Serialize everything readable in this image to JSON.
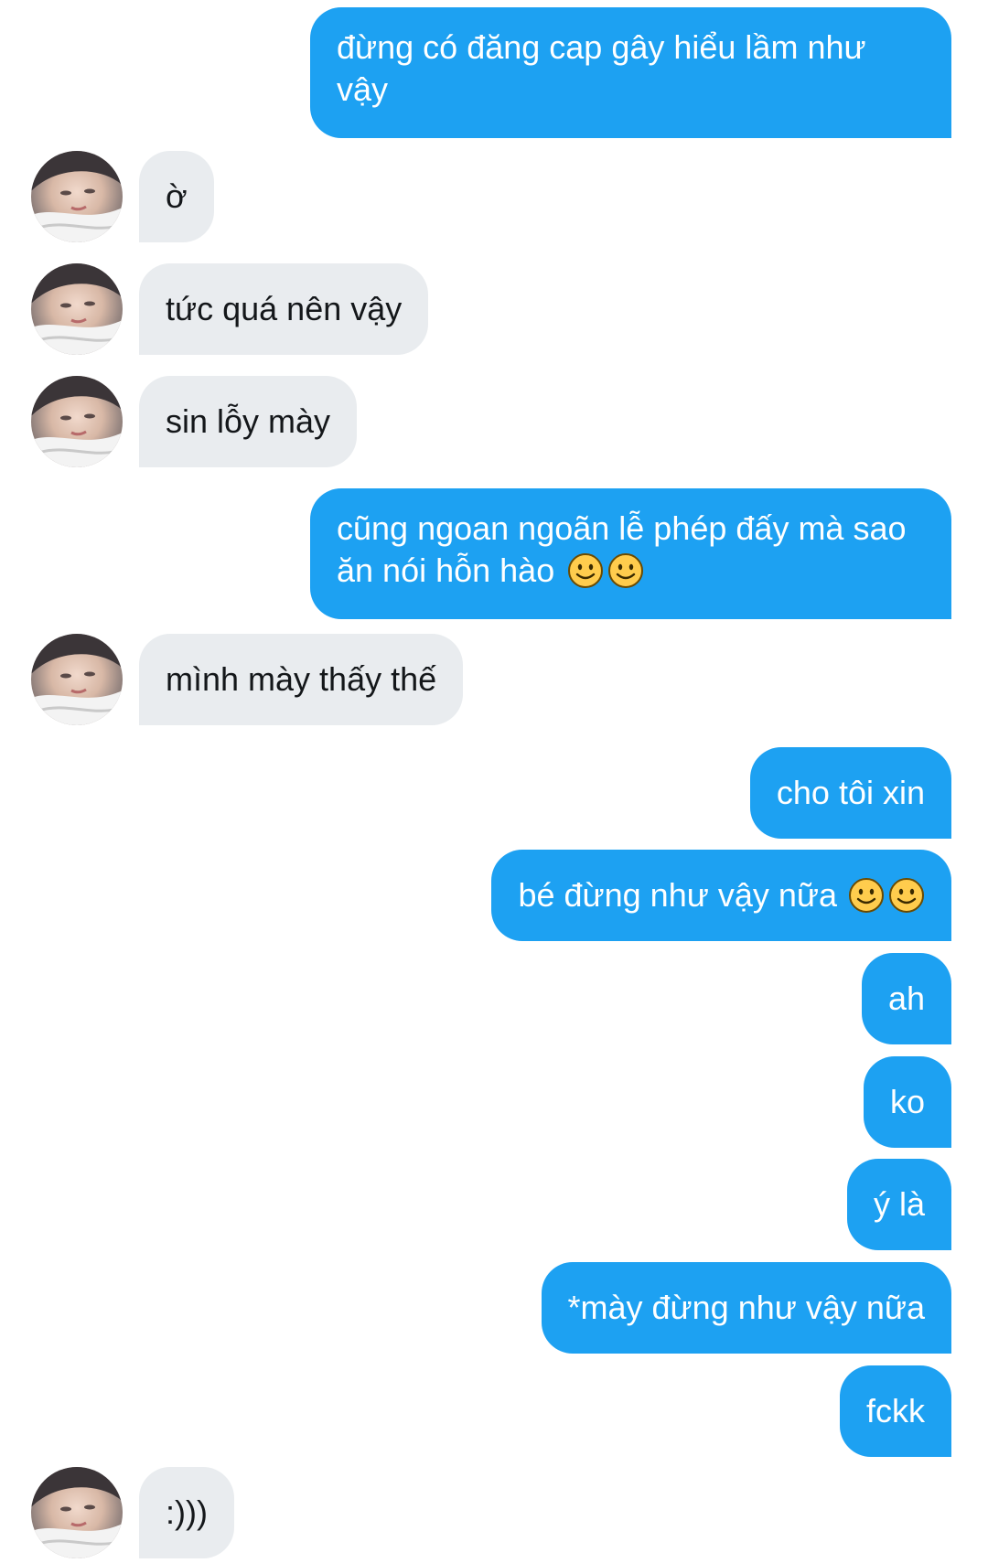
{
  "messages": [
    {
      "side": "sent",
      "text": "đừng có đăng cap gây hiểu lầm như vậy"
    },
    {
      "side": "received",
      "text": "ờ"
    },
    {
      "side": "received",
      "text": "tức quá nên vậy"
    },
    {
      "side": "received",
      "text": "sin lỗy mày"
    },
    {
      "side": "sent",
      "text": "cũng ngoan ngoãn lễ phép đấy mà sao ăn nói hỗn hào",
      "emojis": [
        "slightly-smiling-face-icon",
        "slightly-smiling-face-icon"
      ]
    },
    {
      "side": "received",
      "text": "mình mày thấy thế"
    },
    {
      "side": "sent",
      "text": "cho tôi xin"
    },
    {
      "side": "sent",
      "text": "bé đừng như vậy nữa",
      "emojis": [
        "slightly-smiling-face-icon",
        "slightly-smiling-face-icon"
      ]
    },
    {
      "side": "sent",
      "text": "ah"
    },
    {
      "side": "sent",
      "text": "ko"
    },
    {
      "side": "sent",
      "text": "ý là"
    },
    {
      "side": "sent",
      "text": "*mày đừng như vậy nữa"
    },
    {
      "side": "sent",
      "text": "fckk"
    },
    {
      "side": "received",
      "text": ":)))"
    }
  ],
  "colors": {
    "sent_bubble": "#1da1f2",
    "sent_text": "#ffffff",
    "received_bubble": "#e9ecef",
    "received_text": "#14171a",
    "emoji": "#ffcc4d"
  }
}
